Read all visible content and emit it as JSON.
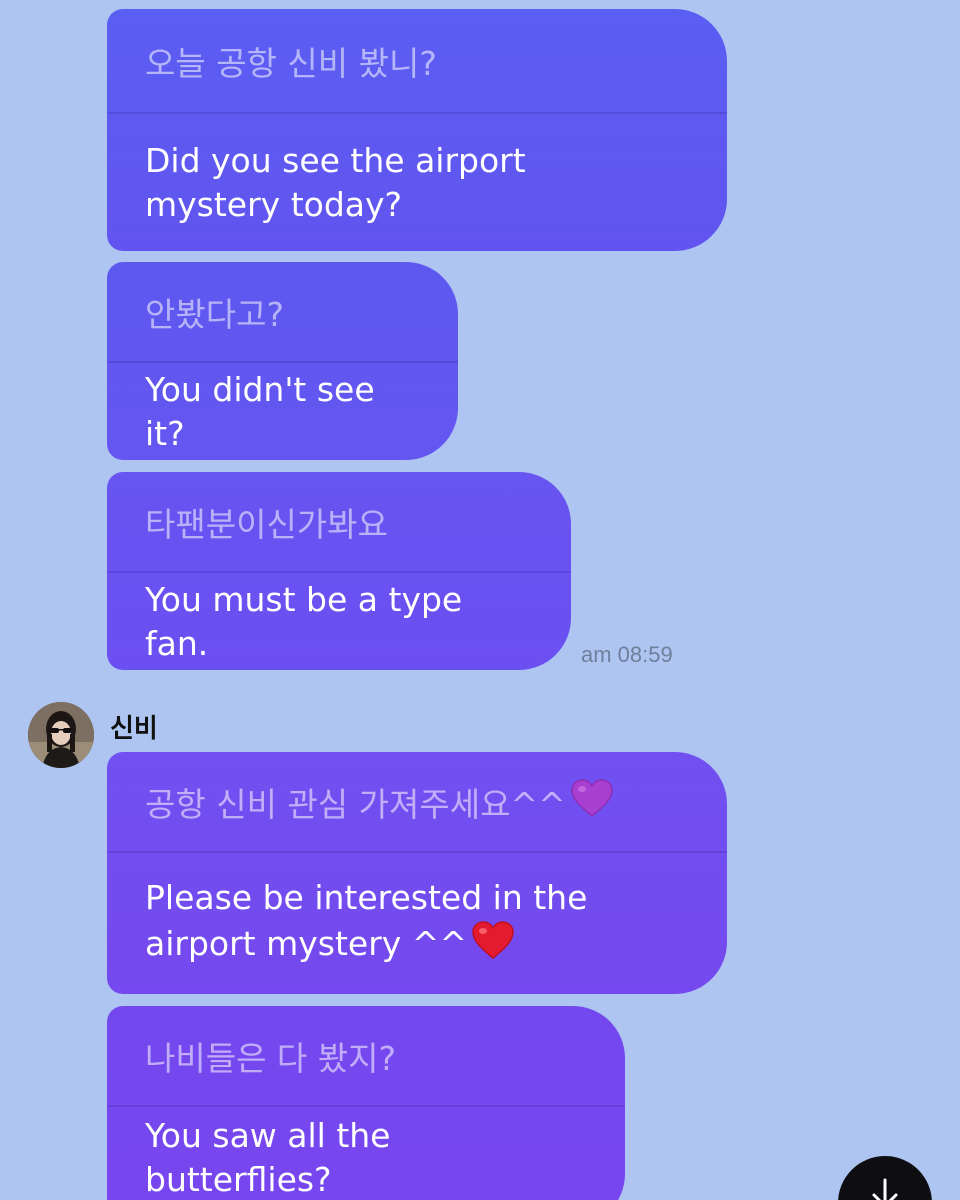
{
  "messages_out": [
    {
      "korean": "오늘 공항 신비 봤니?",
      "english": "Did you see the airport mystery today?"
    },
    {
      "korean": "안봤다고?",
      "english": "You didn't see it?"
    },
    {
      "korean": "타팬분이신가봐요",
      "english": "You must be a type fan."
    }
  ],
  "timestamp": "am 08:59",
  "sender": {
    "name": "신비",
    "avatar_icon": "profile-photo"
  },
  "messages_in": [
    {
      "korean": "공항 신비 관심 가져주세요^^",
      "english": "Please be interested in the airport mystery ^^",
      "korean_emoji": "purple-heart",
      "english_emoji": "red-heart"
    },
    {
      "korean": "나비들은 다 봤지?",
      "english": "You saw all the butterflies?"
    }
  ],
  "scroll_button_icon": "arrow-down-icon",
  "colors": {
    "background": "#adc5f0",
    "bubble_top": "#5a5ef2",
    "bubble_bottom": "#7845ee"
  }
}
